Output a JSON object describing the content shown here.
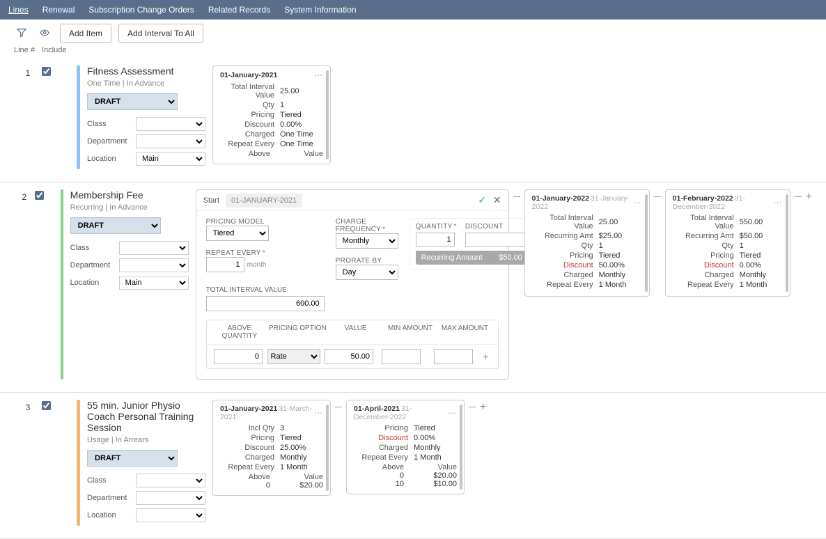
{
  "tabs": [
    "Lines",
    "Renewal",
    "Subscription Change Orders",
    "Related Records",
    "System Information"
  ],
  "active_tab": 0,
  "toolbar": {
    "add_item": "Add Item",
    "add_interval_all": "Add Interval To All"
  },
  "headers": {
    "line": "Line #",
    "include": "Include"
  },
  "common_labels": {
    "class": "Class",
    "department": "Department",
    "location": "Location",
    "total_interval_value": "Total Interval Value",
    "qty": "Qty",
    "pricing": "Pricing",
    "discount": "Discount",
    "charged": "Charged",
    "repeat_every": "Repeat Every",
    "above": "Above",
    "value": "Value",
    "recurring_amt": "Recurring Amt",
    "incl_qty": "Incl Qty"
  },
  "status_options": [
    "DRAFT"
  ],
  "lines": [
    {
      "num": "1",
      "bar_color": "blue",
      "name": "Fitness Assessment",
      "sub": "One Time | In Advance",
      "status": "DRAFT",
      "class": "",
      "department": "",
      "location": "Main",
      "intervals": [
        {
          "start": "01-January-2021",
          "end": "",
          "rows": [
            {
              "k": "Total Interval Value",
              "v": "25.00"
            },
            {
              "k": "Qty",
              "v": "1"
            },
            {
              "k": "Pricing",
              "v": "Tiered"
            },
            {
              "k": "Discount",
              "v": "0.00%"
            },
            {
              "k": "Charged",
              "v": "One Time"
            },
            {
              "k": "Repeat Every",
              "v": "One Time"
            }
          ],
          "tier_header": true
        }
      ]
    },
    {
      "num": "2",
      "bar_color": "green",
      "name": "Membership Fee",
      "sub": "Recurring | In Advance",
      "status": "DRAFT",
      "class": "",
      "department": "",
      "location": "Main",
      "edit_panel": {
        "start_label": "Start",
        "start_value": "01-JANUARY-2021",
        "pricing_model_label": "PRICING MODEL",
        "pricing_model": "Tiered",
        "charge_freq_label": "CHARGE FREQUENCY",
        "charge_freq": "Monthly",
        "repeat_every_label": "REPEAT EVERY",
        "repeat_every_val": "1",
        "repeat_unit": "month",
        "prorate_label": "PRORATE BY",
        "prorate": "Day",
        "quantity_label": "QUANTITY",
        "quantity": "1",
        "discount_label": "DISCOUNT",
        "discount": "",
        "recurring_label": "Recurring Amount",
        "recurring_value": "$50.00",
        "tiv_label": "TOTAL INTERVAL VALUE",
        "tiv_value": "600.00",
        "tier_cols": [
          "ABOVE QUANTITY",
          "PRICING OPTION",
          "VALUE",
          "MIN AMOUNT",
          "MAX AMOUNT"
        ],
        "tier_row": {
          "above": "0",
          "option": "Rate",
          "value": "50.00",
          "min": "",
          "max": ""
        }
      },
      "intervals": [
        {
          "start": "01-January-2022",
          "end": "31-January-2022",
          "rows": [
            {
              "k": "Total Interval Value",
              "v": "25.00"
            },
            {
              "k": "Recurring Amt",
              "v": "$25.00"
            },
            {
              "k": "Qty",
              "v": "1"
            },
            {
              "k": "Pricing",
              "v": "Tiered"
            },
            {
              "k": "Discount",
              "v": "50.00%",
              "red": true
            },
            {
              "k": "Charged",
              "v": "Monthly"
            },
            {
              "k": "Repeat Every",
              "v": "1 Month"
            }
          ]
        },
        {
          "start": "01-February-2022",
          "end": "31-December-2022",
          "rows": [
            {
              "k": "Total Interval Value",
              "v": "550.00"
            },
            {
              "k": "Recurring Amt",
              "v": "$50.00"
            },
            {
              "k": "Qty",
              "v": "1"
            },
            {
              "k": "Pricing",
              "v": "Tiered"
            },
            {
              "k": "Discount",
              "v": "0.00%",
              "red": true
            },
            {
              "k": "Charged",
              "v": "Monthly"
            },
            {
              "k": "Repeat Every",
              "v": "1 Month"
            }
          ]
        }
      ]
    },
    {
      "num": "3",
      "bar_color": "orange",
      "name": "55 min. Junior Physio Coach Personal Training Session",
      "sub": "Usage | In Arrears",
      "status": "DRAFT",
      "class": "",
      "department": "",
      "location": "",
      "intervals": [
        {
          "start": "01-January-2021",
          "end": "31-March-2021",
          "rows": [
            {
              "k": "Incl Qty",
              "v": "3"
            },
            {
              "k": "Pricing",
              "v": "Tiered"
            },
            {
              "k": "Discount",
              "v": "25.00%"
            },
            {
              "k": "Charged",
              "v": "Monthly"
            },
            {
              "k": "Repeat Every",
              "v": "1 Month"
            }
          ],
          "tiers": [
            [
              "0",
              "$20.00"
            ]
          ]
        },
        {
          "start": "01-April-2021",
          "end": "31-December-2022",
          "rows": [
            {
              "k": "Pricing",
              "v": "Tiered"
            },
            {
              "k": "Discount",
              "v": "0.00%",
              "red": true
            },
            {
              "k": "Charged",
              "v": "Monthly"
            },
            {
              "k": "Repeat Every",
              "v": "1 Month"
            }
          ],
          "tiers": [
            [
              "0",
              "$20.00"
            ],
            [
              "10",
              "$10.00"
            ]
          ]
        }
      ]
    }
  ]
}
